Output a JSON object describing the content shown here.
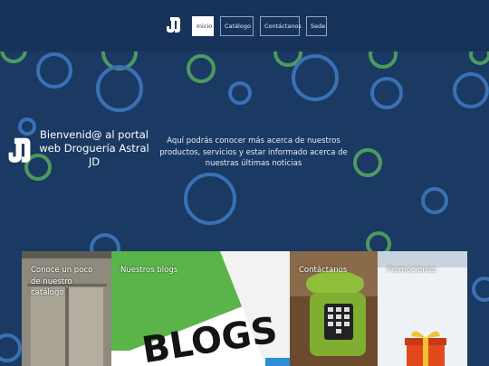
{
  "nav": {
    "items": [
      {
        "label": "Inicio",
        "active": true
      },
      {
        "label": "Catálogo",
        "active": false
      },
      {
        "label": "Contáctanos",
        "active": false
      },
      {
        "label": "Sede",
        "active": false
      }
    ]
  },
  "hero": {
    "welcome": "Bienvenid@ al portal web Droguería Astral JD",
    "intro": "Aquí podrás conocer más acerca de nuestros productos, servicios y estar informado acerca de nuestras últimas noticias"
  },
  "cards": [
    {
      "label": "Conoce un poco de nuestro catálogo"
    },
    {
      "label": "Nuestros blogs",
      "image_text": "BLOGS"
    },
    {
      "label": "Contáctanos"
    },
    {
      "label": "Promociones"
    }
  ],
  "colors": {
    "header_bg": "#17335a",
    "hero_bg": "#1a3a63",
    "ring_blue": "#3a70b4",
    "ring_green": "#4e9a5e"
  }
}
